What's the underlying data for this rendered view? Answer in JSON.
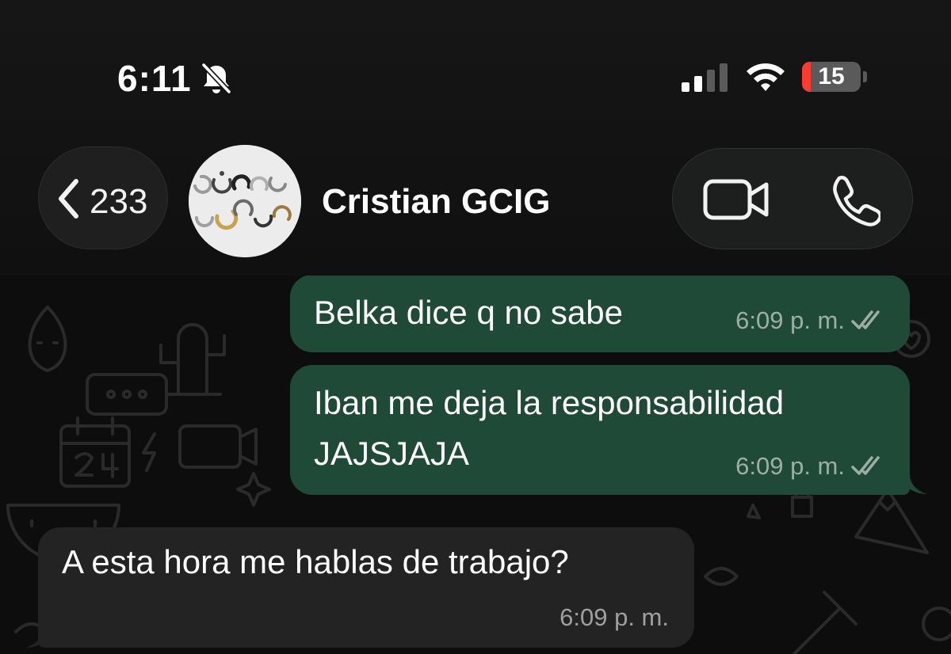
{
  "status_bar": {
    "time": "6:11",
    "battery_level": "15",
    "icons": [
      "bell-slash-icon",
      "cellular-signal-icon",
      "wifi-icon",
      "battery-icon"
    ]
  },
  "header": {
    "back_count": "233",
    "contact_name": "Cristian GCIG",
    "icons": [
      "chevron-left-icon",
      "video-camera-icon",
      "phone-icon"
    ]
  },
  "messages": [
    {
      "direction": "outgoing",
      "text": "Belka dice q no sabe",
      "time": "6:09 p. m.",
      "status_icon": "double-check-icon"
    },
    {
      "direction": "outgoing",
      "text_lines": [
        "Iban me deja la responsabilidad",
        "JAJSJAJA"
      ],
      "time": "6:09 p. m.",
      "status_icon": "double-check-icon"
    },
    {
      "direction": "incoming",
      "text": "A esta hora me hablas de trabajo?",
      "time": "6:09 p. m."
    }
  ],
  "colors": {
    "outgoing_bubble": "#1f4a38",
    "incoming_bubble": "#232323",
    "background": "#0d0d0d",
    "battery_low": "#ff3b30"
  }
}
